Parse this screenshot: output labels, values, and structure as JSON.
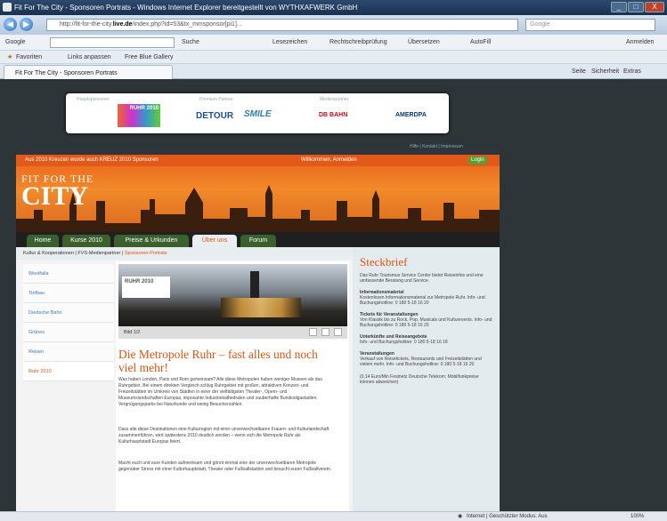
{
  "window": {
    "title": "Fit For The City - Sponsoren Portrats - Windows Internet Explorer bereitgestellt von WYTHXAFWERK GmbH",
    "min": "_",
    "max": "□",
    "close": "X"
  },
  "address": {
    "url_prefix": "http://fit-for-the-city.",
    "url_bold": "live.de",
    "url_suffix": "/index.php?id=53&tx_mmsponsor[pi1]...",
    "search_placeholder": "Google"
  },
  "googlebar": {
    "label": "Google",
    "items": [
      "Suche",
      "Lesezeichen",
      "Rechtschreibprüfung",
      "Übersetzen",
      "AutoFill",
      "Anmelden"
    ]
  },
  "favorites": {
    "label": "Favoriten",
    "items": [
      "Links anpassen",
      "Free Blue Gallery"
    ]
  },
  "tab": {
    "label": "Fit For The City - Sponsoren Portrats",
    "commands": [
      "Seite",
      "Sicherheit",
      "Extras"
    ]
  },
  "sponsor_bar": {
    "labels": [
      "Hauptsponsoren",
      "Premium Partner",
      "Medienpartner"
    ],
    "logos": [
      "RUHR 2010",
      "DETOUR",
      "SMILE",
      "DB BAHN",
      "AMERDPA"
    ]
  },
  "top_links": "Hilfe | Kontakt | Impressum",
  "banner": {
    "top_text": "Aus 2010 Kreuzen wurde auch KREUZ 2010 Sponsoren",
    "login_text": "Willkommen, Anmelden",
    "btn": "Login",
    "fit": "FIT FOR THE",
    "city": "CITY"
  },
  "nav": {
    "tabs": [
      "Home",
      "Kurse 2010",
      "Preise & Urkunden",
      "Über uns",
      "Forum"
    ]
  },
  "breadcrumb": {
    "path": "Kultur & Kooperationen | FVS-Medienpartner |",
    "current": "Sponsoren-Portrats"
  },
  "leftnav": {
    "items": [
      "Westfalia",
      "Tiefbau",
      "Deutsche Bahn",
      "Grünes",
      "Reisen",
      "Ruhr 2010"
    ]
  },
  "main": {
    "photo_logo": "RUHR 2010",
    "caption": "Bild 1/2",
    "heading": "Die Metropole Ruhr – fast alles und noch viel mehr!",
    "p1": "Was haben London, Paris und Rom gemeinsam? Alle diese Metropolen haben weniger Museen als das Ruhrgebiet. Bei einem direkten Vergleich schlug Ruhrgebiet mit großen, attraktiven Konzert- und Freizeitstätten im Umkreis von Städten in einer der vielfältigsten Theater-, Opern- und Museumslandschaften Europas, imposante Industriekathedralen und zauberhafte Bundesligastadien. Vergnügungsparks bei Naturkunde und wenig Besucherzahlen.",
    "p2": "Dass alle diese Destinationen eine Kulturregion mit einer unverwechselbaren Frauen- und Kulturlandschaft zusammenführen, wird spätestens 2010 deutlich werden – wenn sich die Metropole Ruhr als Kulturhauptstadt Europas feiert.",
    "p3": "Macht euch und eure Kunden aufmerksam und gönnt einmal eine der unverwechselbaren Metropole gegenüber Stress mit einer Kulturhauptstadt, Theater oder Fußballstadion und besucht euren Fußballverein."
  },
  "steckbrief": {
    "title": "Steckbrief",
    "intro": "Das Ruhr Tourismus Service Center bietet Reiseinfos und eine umfassende Beratung und Service.",
    "sections": [
      {
        "h": "Informationsmaterial",
        "t": "Kostenlosen Informationsmaterial zur Metropole Ruhr. Info- und Buchungshotline: 0 180 5-18 16 20"
      },
      {
        "h": "Tickets für Veranstaltungen",
        "t": "Von Klassik bis zu Rock, Pop, Musicals und Kulturevents. Info- und Buchungshotline: 0 180 5-18 16 20"
      },
      {
        "h": "Unterkünfte und Reiseangebote",
        "t": "Info- und Buchungshotline: 0 180 5-18 16 18"
      },
      {
        "h": "Veranstaltungen",
        "t": "Verkauf von Reisetickets, Restaurants und Freizeitstätten und vielem mehr. Info- und Buchungshotline: 0 180 5-18 16 20"
      }
    ],
    "footer": "(0,14 Euro/Min Festnetz Deutsche Telekom; Mobilfunkpreise können abweichen)"
  },
  "status": {
    "left": "",
    "zone": "Internet | Geschützter Modus: Aus",
    "zoom": "100%"
  }
}
